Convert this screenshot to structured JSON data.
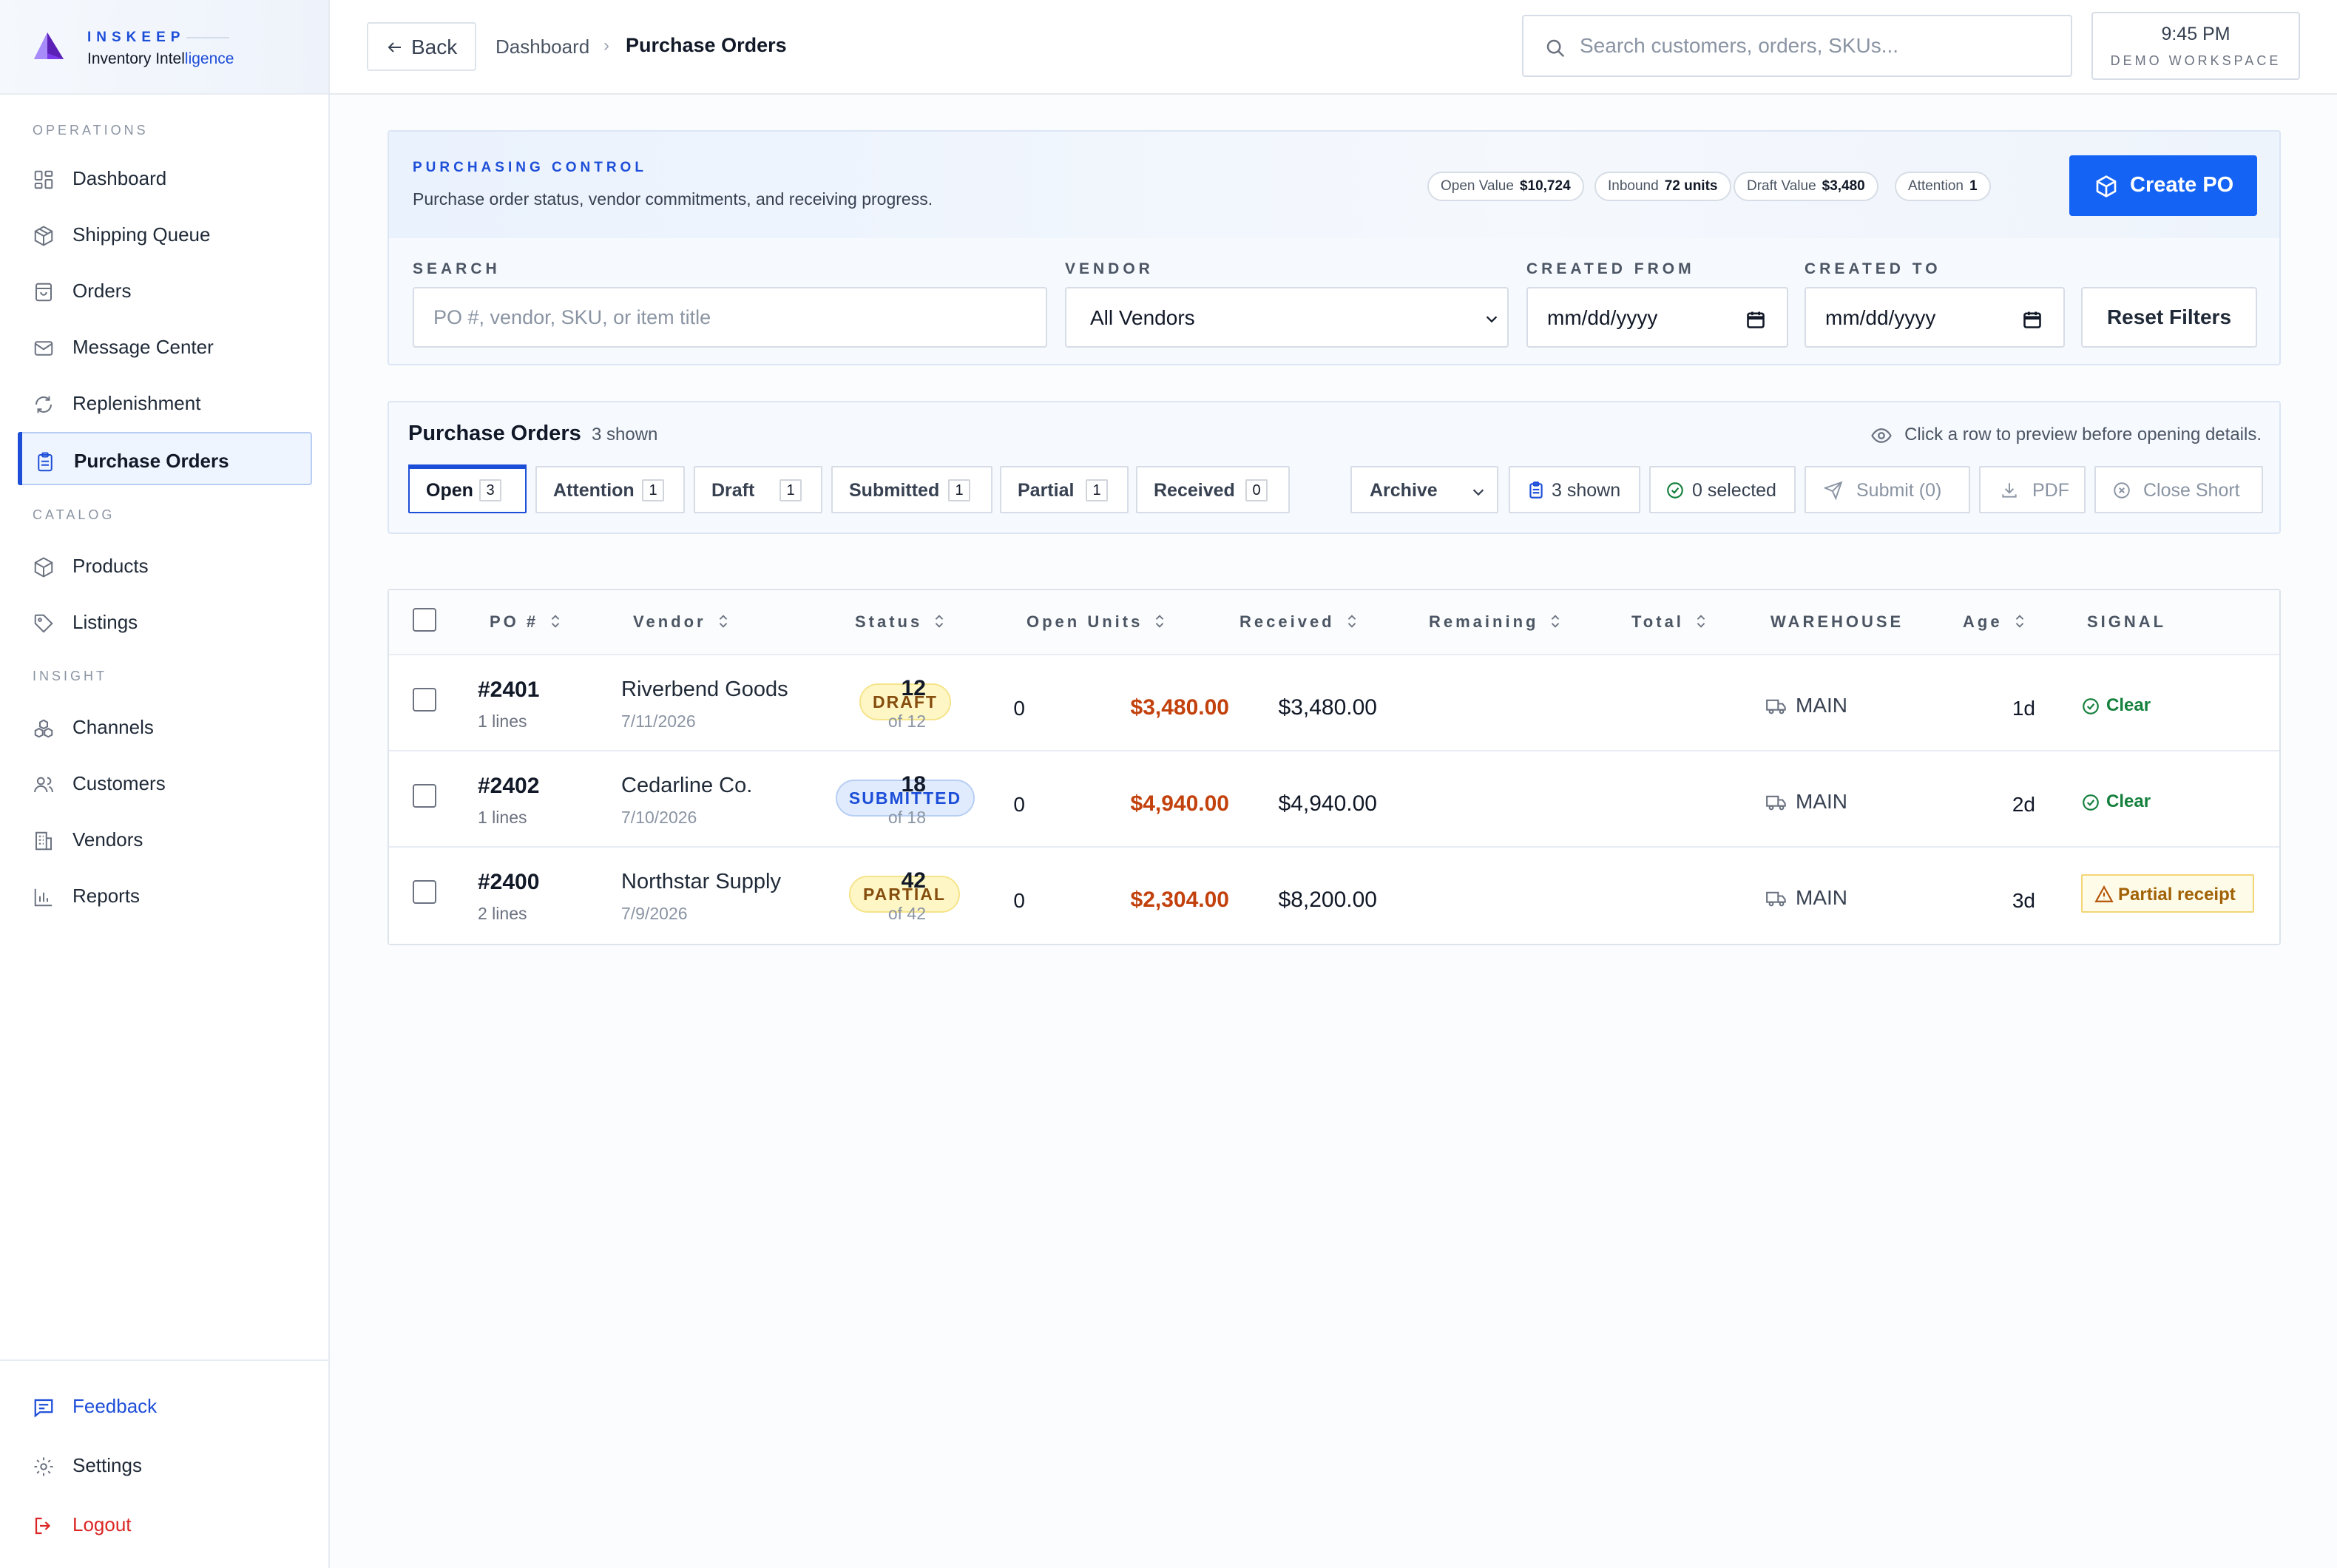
{
  "brand": {
    "name": "INSKEEP",
    "tagline_prefix": "Inventory Intel",
    "tagline_highlight": "ligence"
  },
  "sidebar": {
    "sections": {
      "operations": "OPERATIONS",
      "catalog": "CATALOG",
      "insight": "INSIGHT"
    },
    "items": [
      {
        "label": "Dashboard",
        "icon": "grid-icon"
      },
      {
        "label": "Shipping Queue",
        "icon": "package-icon"
      },
      {
        "label": "Orders",
        "icon": "inbox-icon"
      },
      {
        "label": "Message Center",
        "icon": "mail-icon"
      },
      {
        "label": "Replenishment",
        "icon": "refresh-icon"
      },
      {
        "label": "Purchase Orders",
        "icon": "clipboard-icon",
        "active": true
      },
      {
        "label": "Products",
        "icon": "box-icon"
      },
      {
        "label": "Listings",
        "icon": "tag-icon"
      },
      {
        "label": "Channels",
        "icon": "channels-icon"
      },
      {
        "label": "Customers",
        "icon": "users-icon"
      },
      {
        "label": "Vendors",
        "icon": "building-icon"
      },
      {
        "label": "Reports",
        "icon": "bar-chart-icon"
      }
    ],
    "footer": [
      {
        "label": "Feedback",
        "icon": "feedback-icon"
      },
      {
        "label": "Settings",
        "icon": "gear-icon"
      },
      {
        "label": "Logout",
        "icon": "logout-icon"
      }
    ]
  },
  "topbar": {
    "back_label": "Back",
    "breadcrumb": [
      "Dashboard",
      "Purchase Orders"
    ],
    "breadcrumb_sep": "›",
    "search_placeholder": "Search customers, orders, SKUs...",
    "time": "9:45 PM",
    "workspace": "DEMO WORKSPACE"
  },
  "control": {
    "eyebrow": "PURCHASING CONTROL",
    "subtitle": "Purchase order status, vendor commitments, and receiving progress.",
    "chips": [
      {
        "label": "Open Value",
        "value": "$10,724"
      },
      {
        "label": "Inbound",
        "value": "72 units"
      },
      {
        "label": "Draft Value",
        "value": "$3,480"
      },
      {
        "label": "Attention",
        "value": "1"
      }
    ],
    "create_label": "Create PO",
    "filters": {
      "search_label": "SEARCH",
      "search_placeholder": "PO #, vendor, SKU, or item title",
      "vendor_label": "VENDOR",
      "vendor_value": "All Vendors",
      "from_label": "CREATED FROM",
      "from_value": "mm/dd/yyyy",
      "to_label": "CREATED TO",
      "to_value": "mm/dd/yyyy",
      "reset_label": "Reset Filters"
    }
  },
  "po_panel": {
    "title": "Purchase Orders",
    "shown": "3 shown",
    "hint": "Click a row to preview before opening details.",
    "tabs": [
      {
        "label": "Open",
        "count": "3",
        "active": true
      },
      {
        "label": "Attention",
        "count": "1"
      },
      {
        "label": "Draft",
        "count": "1"
      },
      {
        "label": "Submitted",
        "count": "1"
      },
      {
        "label": "Partial",
        "count": "1"
      },
      {
        "label": "Received",
        "count": "0"
      }
    ],
    "archive_value": "Archive",
    "shown_btn": "3 shown",
    "selected_btn": "0 selected",
    "submit_btn": "Submit (0)",
    "pdf_btn": "PDF",
    "close_short_btn": "Close Short"
  },
  "table": {
    "headers": {
      "po": "PO #",
      "vendor": "Vendor",
      "status": "Status",
      "open_units": "Open Units",
      "received": "Received",
      "remaining": "Remaining",
      "total": "Total",
      "warehouse": "WAREHOUSE",
      "age": "Age",
      "signal": "SIGNAL"
    },
    "rows": [
      {
        "po": "#2401",
        "lines": "1 lines",
        "vendor": "Riverbend Goods",
        "date": "7/11/2026",
        "status": "DRAFT",
        "units": "12",
        "of": "of 12",
        "received": "0",
        "remaining": "$3,480.00",
        "total": "$3,480.00",
        "warehouse": "MAIN",
        "age": "1d",
        "signal": "Clear"
      },
      {
        "po": "#2402",
        "lines": "1 lines",
        "vendor": "Cedarline Co.",
        "date": "7/10/2026",
        "status": "SUBMITTED",
        "units": "18",
        "of": "of 18",
        "received": "0",
        "remaining": "$4,940.00",
        "total": "$4,940.00",
        "warehouse": "MAIN",
        "age": "2d",
        "signal": "Clear"
      },
      {
        "po": "#2400",
        "lines": "2 lines",
        "vendor": "Northstar Supply",
        "date": "7/9/2026",
        "status": "PARTIAL",
        "units": "42",
        "of": "of 42",
        "received": "0",
        "remaining": "$2,304.00",
        "total": "$8,200.00",
        "warehouse": "MAIN",
        "age": "3d",
        "signal": "Partial receipt"
      }
    ]
  }
}
